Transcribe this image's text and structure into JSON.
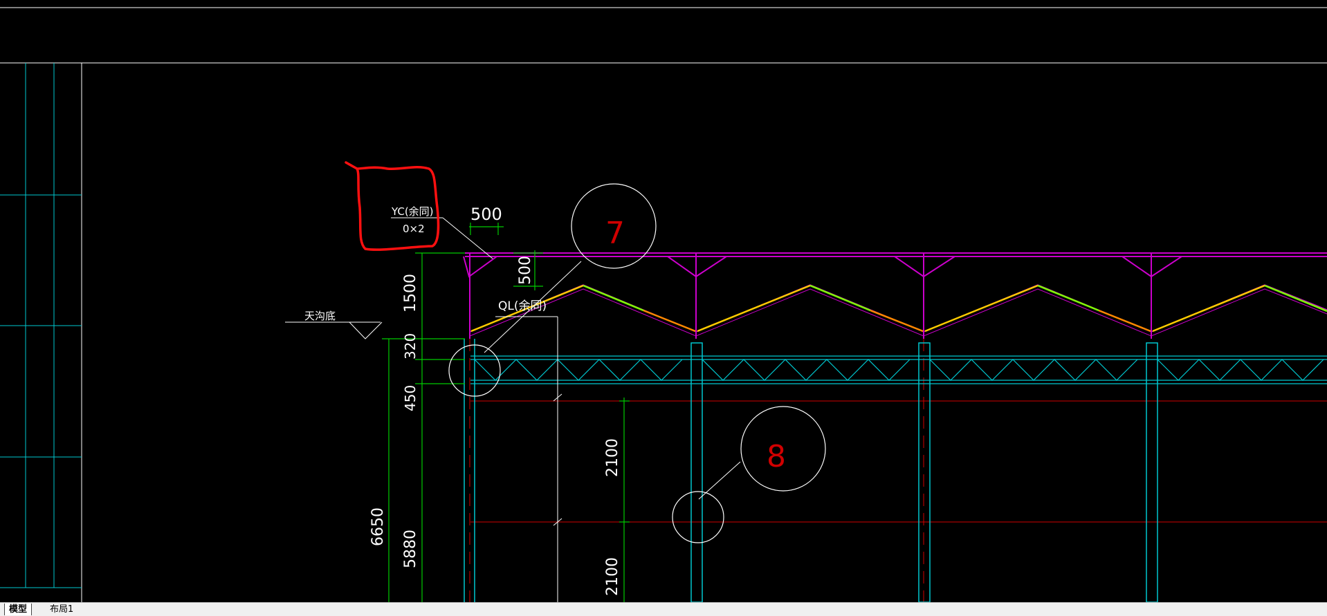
{
  "tabs": [
    {
      "label": "模型",
      "active": true
    },
    {
      "label": "布局1",
      "active": false
    }
  ],
  "drawing": {
    "section_label": {
      "top": "YC(余同)",
      "bottom": "0×2"
    },
    "gutter_label": "天沟底",
    "purlin_label": "QL(余同)",
    "detail_markers": [
      "7",
      "8"
    ],
    "dimensions": {
      "top_width": "500",
      "small_vertical": "500",
      "h1500": "1500",
      "h320": "320",
      "h450": "450",
      "h6650": "6650",
      "h5880": "5880",
      "h2100a": "2100",
      "h2100b": "2100"
    }
  },
  "colors": {
    "background": "#000000",
    "truss": "#cc00cc",
    "column": "#00c8d0",
    "dimension": "#00cc00",
    "axis": "#d00000",
    "roof_green": "#7fff00",
    "roof_yellow": "#ffcc00",
    "text": "#ffffff",
    "markup": "#ff0000",
    "marker_text": "#d00000"
  }
}
